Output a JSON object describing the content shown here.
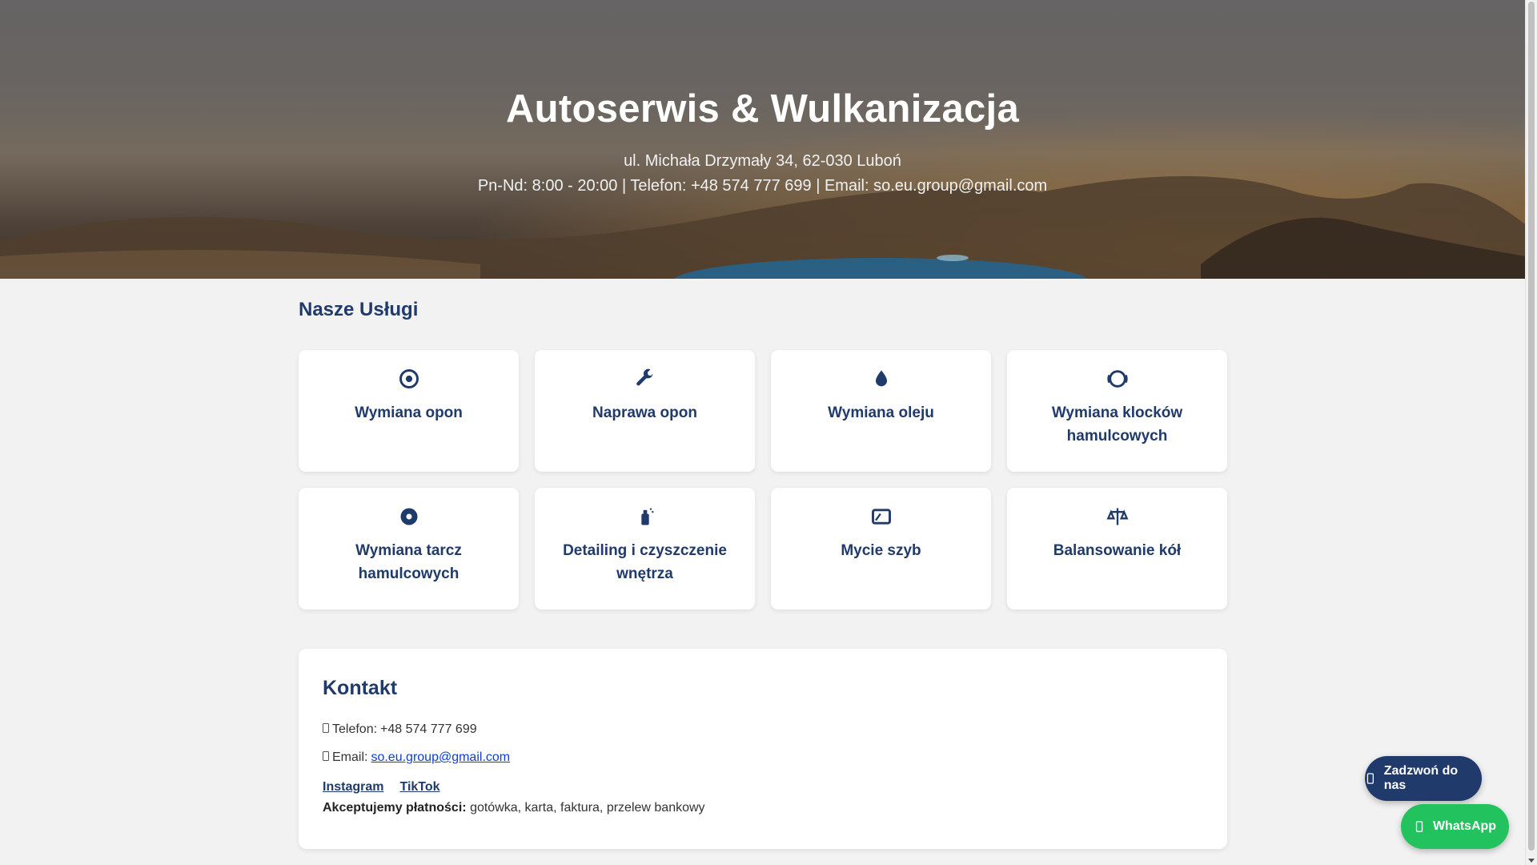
{
  "hero": {
    "title": "Autoserwis & Wulkanizacja",
    "address": "ul. Michała Drzymały 34, 62-030 Luboń",
    "info": "Pn-Nd: 8:00 - 20:00 | Telefon: +48 574 777 699 | Email: so.eu.group@gmail.com"
  },
  "services": {
    "title": "Nasze Usługi",
    "items": [
      {
        "label": "Wymiana opon",
        "icon": "tire-icon"
      },
      {
        "label": "Naprawa opon",
        "icon": "wrench-icon"
      },
      {
        "label": "Wymiana oleju",
        "icon": "oil-icon"
      },
      {
        "label": "Wymiana klocków hamulcowych",
        "icon": "brake-icon"
      },
      {
        "label": "Wymiana tarcz hamulcowych",
        "icon": "disc-icon"
      },
      {
        "label": "Detailing i czyszczenie wnętrza",
        "icon": "spray-icon"
      },
      {
        "label": "Mycie szyb",
        "icon": "window-icon"
      },
      {
        "label": "Balansowanie kół",
        "icon": "balance-icon"
      }
    ]
  },
  "contact": {
    "title": "Kontakt",
    "phone_label": "Telefon:",
    "phone": "+48 574 777 699",
    "email_label": "Email:",
    "email": "so.eu.group@gmail.com",
    "social": [
      "Instagram",
      "TikTok"
    ],
    "payment_label": "Akceptujemy płatności:",
    "payment_methods": "gotówka, karta, faktura, przelew bankowy"
  },
  "floating": {
    "call_label": "Zadzwoń do nas",
    "whatsapp_label": "WhatsApp"
  },
  "colors": {
    "accent": "#1f3a6b",
    "whatsapp": "#22c35e",
    "link": "#0b3fd6"
  }
}
